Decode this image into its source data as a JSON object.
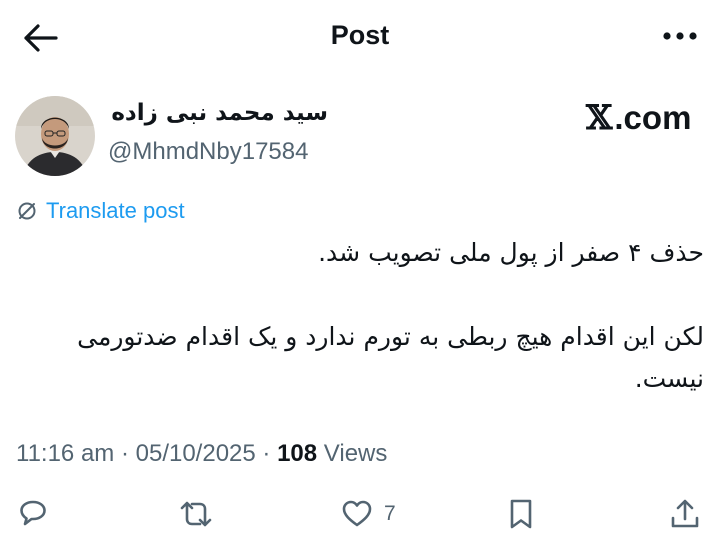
{
  "header": {
    "title": "Post",
    "back_icon": "arrow-left-icon",
    "more_icon": "more-horizontal-icon"
  },
  "author": {
    "display_name": "سید محمد نبی زاده",
    "handle": "@MhmdNby17584",
    "avatar": "avatar-photo"
  },
  "source": {
    "logo": "𝕏",
    "suffix": ".com"
  },
  "translate": {
    "label": "Translate post",
    "icon": "translate-icon"
  },
  "tweet": {
    "text": "حذف ۴ صفر از پول ملی تصویب شد.\n\nلکن این اقدام هیچ ربطی به تورم ندارد و یک اقدام ضدتورمی نیست."
  },
  "meta": {
    "time": "11:16 am",
    "separator": " · ",
    "date": "05/10/2025",
    "views_count": "108",
    "views_label": " Views"
  },
  "actions": {
    "reply_icon": "reply-icon",
    "repost_icon": "repost-icon",
    "like_icon": "heart-icon",
    "like_count": "7",
    "bookmark_icon": "bookmark-icon",
    "share_icon": "share-icon"
  },
  "colors": {
    "text": "#0f1419",
    "muted": "#536471",
    "accent": "#1d9bf0",
    "background": "#ffffff"
  }
}
